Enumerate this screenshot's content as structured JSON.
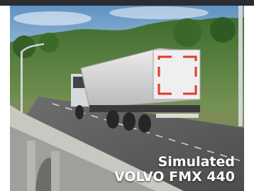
{
  "caption": {
    "line1": "Simulated",
    "line2": "VOLVO FMX 440"
  },
  "colors": {
    "sky": "#6f9fc6",
    "trees": "#4e7a3a",
    "road": "#5b5c5c",
    "trailer": "#d8d8d8",
    "accent_red": "#e23a2c",
    "caption_text": "#ffffff"
  }
}
